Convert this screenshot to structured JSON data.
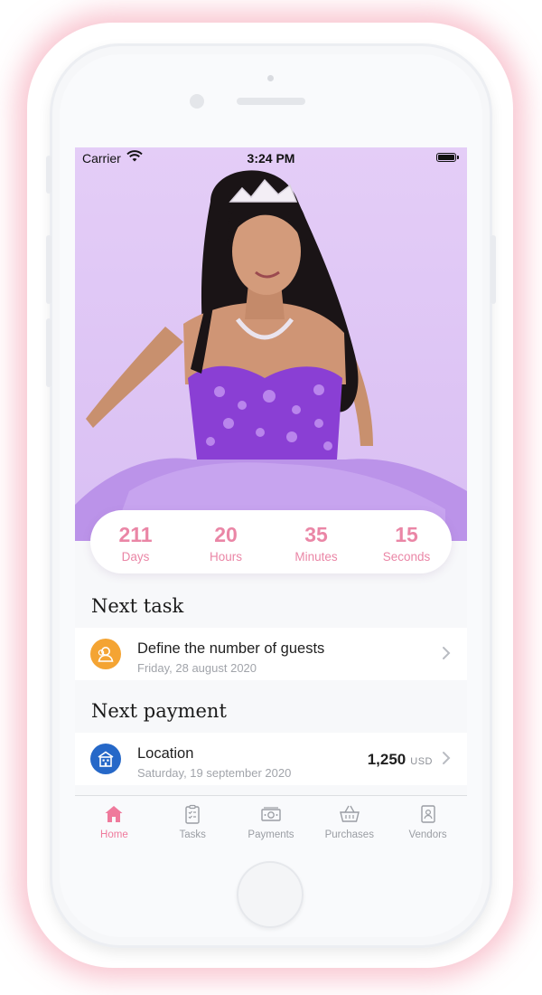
{
  "status_bar": {
    "carrier": "Carrier",
    "time": "3:24 PM"
  },
  "countdown": [
    {
      "value": "211",
      "label": "Days"
    },
    {
      "value": "20",
      "label": "Hours"
    },
    {
      "value": "35",
      "label": "Minutes"
    },
    {
      "value": "15",
      "label": "Seconds"
    }
  ],
  "next_task": {
    "section_title": "Next task",
    "title": "Define the number of guests",
    "date": "Friday, 28 august 2020",
    "icon": "guests-icon",
    "icon_color": "#f4a433"
  },
  "next_payment": {
    "section_title": "Next payment",
    "title": "Location",
    "date": "Saturday, 19 september 2020",
    "amount": "1,250",
    "currency": "USD",
    "icon": "building-icon",
    "icon_color": "#2668c8"
  },
  "tabbar": {
    "items": [
      {
        "label": "Home",
        "icon": "home-icon",
        "active": true
      },
      {
        "label": "Tasks",
        "icon": "clipboard-icon",
        "active": false
      },
      {
        "label": "Payments",
        "icon": "money-icon",
        "active": false
      },
      {
        "label": "Purchases",
        "icon": "basket-icon",
        "active": false
      },
      {
        "label": "Vendors",
        "icon": "contact-book-icon",
        "active": false
      }
    ]
  },
  "colors": {
    "accent": "#ea86a6",
    "hero_bg": "#dcc3f4",
    "tab_active": "#ef7a9c"
  }
}
